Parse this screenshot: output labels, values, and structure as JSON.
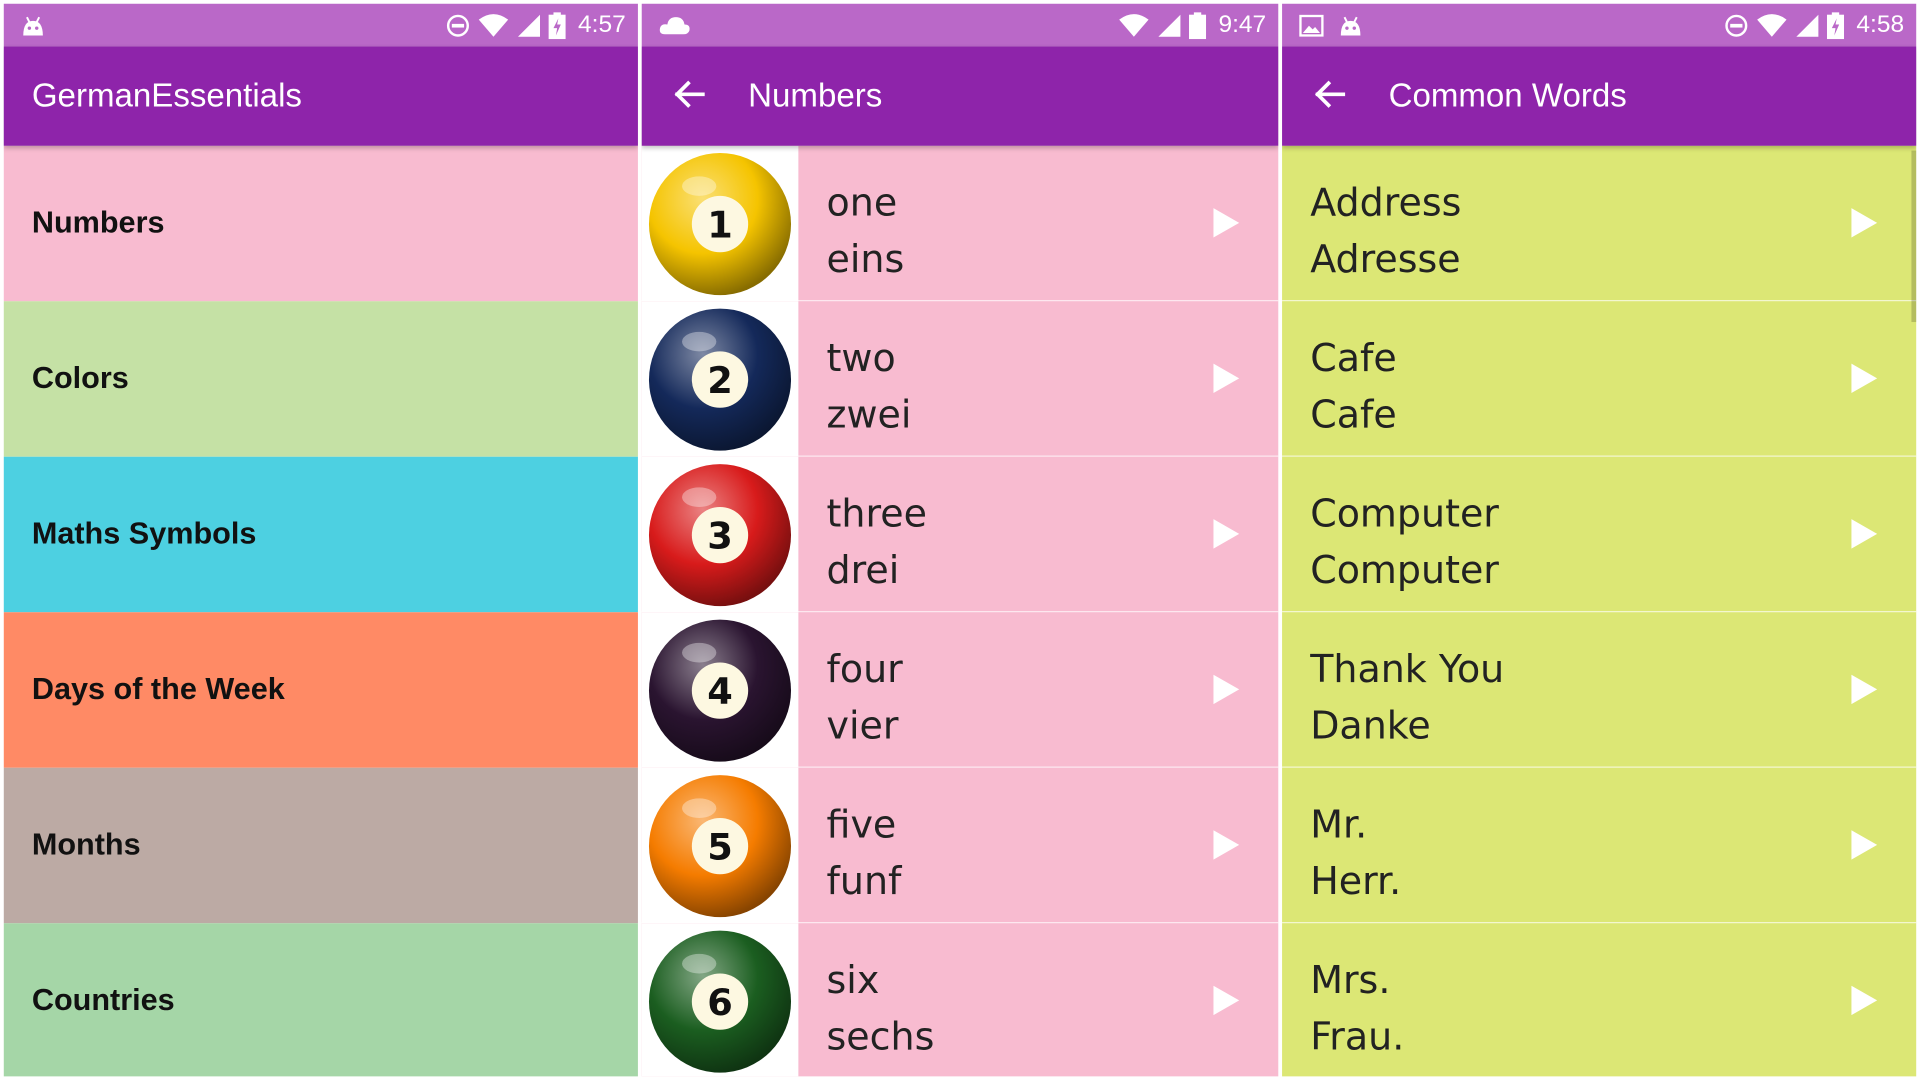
{
  "panels": [
    {
      "status": {
        "time": "4:57",
        "left_icons": [
          "android-icon"
        ],
        "right_icons": [
          "do-not-disturb-icon",
          "wifi-icon",
          "cell-signal-icon",
          "battery-charging-icon"
        ]
      },
      "title": "GermanEssentials",
      "categories": [
        {
          "label": "Numbers",
          "color": "#f8bbd0"
        },
        {
          "label": "Colors",
          "color": "#c5e1a5"
        },
        {
          "label": "Maths Symbols",
          "color": "#4dd0e1"
        },
        {
          "label": "Days of the Week",
          "color": "#ff8a65"
        },
        {
          "label": "Months",
          "color": "#bcaaa4"
        },
        {
          "label": "Countries",
          "color": "#a5d6a7"
        }
      ]
    },
    {
      "status": {
        "time": "9:47",
        "left_icons": [
          "cloud-icon"
        ],
        "right_icons": [
          "wifi-icon",
          "cell-signal-icon",
          "battery-icon"
        ]
      },
      "title": "Numbers",
      "back_icon": "arrow-back-icon",
      "items": [
        {
          "en": "one",
          "de": "eins",
          "ball_number": "1",
          "ball_color": "#f5c400",
          "icon": "billiard-ball-1-icon"
        },
        {
          "en": "two",
          "de": "zwei",
          "ball_number": "2",
          "ball_color": "#14295a",
          "icon": "billiard-ball-2-icon"
        },
        {
          "en": "three",
          "de": "drei",
          "ball_number": "3",
          "ball_color": "#d81b1b",
          "icon": "billiard-ball-3-icon"
        },
        {
          "en": "four",
          "de": "vier",
          "ball_number": "4",
          "ball_color": "#2a1430",
          "icon": "billiard-ball-4-icon"
        },
        {
          "en": "five",
          "de": "funf",
          "ball_number": "5",
          "ball_color": "#f57c00",
          "icon": "billiard-ball-5-icon"
        },
        {
          "en": "six",
          "de": "sechs",
          "ball_number": "6",
          "ball_color": "#1b5e20",
          "icon": "billiard-ball-6-icon"
        }
      ]
    },
    {
      "status": {
        "time": "4:58",
        "left_icons": [
          "image-icon",
          "android-icon"
        ],
        "right_icons": [
          "do-not-disturb-icon",
          "wifi-icon",
          "cell-signal-icon",
          "battery-charging-icon"
        ]
      },
      "title": "Common Words",
      "back_icon": "arrow-back-icon",
      "items": [
        {
          "en": "Address",
          "de": "Adresse"
        },
        {
          "en": "Cafe",
          "de": "Cafe"
        },
        {
          "en": "Computer",
          "de": "Computer"
        },
        {
          "en": "Thank You",
          "de": "Danke"
        },
        {
          "en": "Mr.",
          "de": "Herr."
        },
        {
          "en": "Mrs.",
          "de": "Frau."
        }
      ]
    }
  ],
  "colors": {
    "status_bar": "#ba68c8",
    "app_bar": "#8e24aa",
    "numbers_row": "#f8bbd0",
    "common_words_row": "#dce775"
  },
  "play_icon": "play-arrow-icon"
}
